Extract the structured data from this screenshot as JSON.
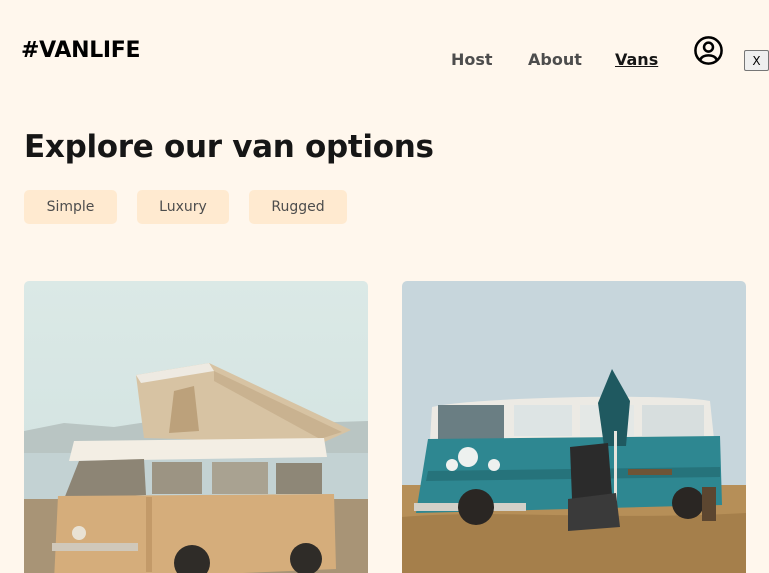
{
  "header": {
    "logo": "#VANLIFE",
    "nav": [
      {
        "label": "Host"
      },
      {
        "label": "About"
      },
      {
        "label": "Vans",
        "active": true
      }
    ],
    "close_label": "X"
  },
  "main": {
    "title": "Explore our van options",
    "filters": [
      {
        "label": "Simple"
      },
      {
        "label": "Luxury"
      },
      {
        "label": "Rugged"
      }
    ]
  },
  "colors": {
    "background": "#fff7ed",
    "filter_bg": "#ffead0",
    "text": "#161616",
    "nav_text": "#4d4d4d"
  }
}
